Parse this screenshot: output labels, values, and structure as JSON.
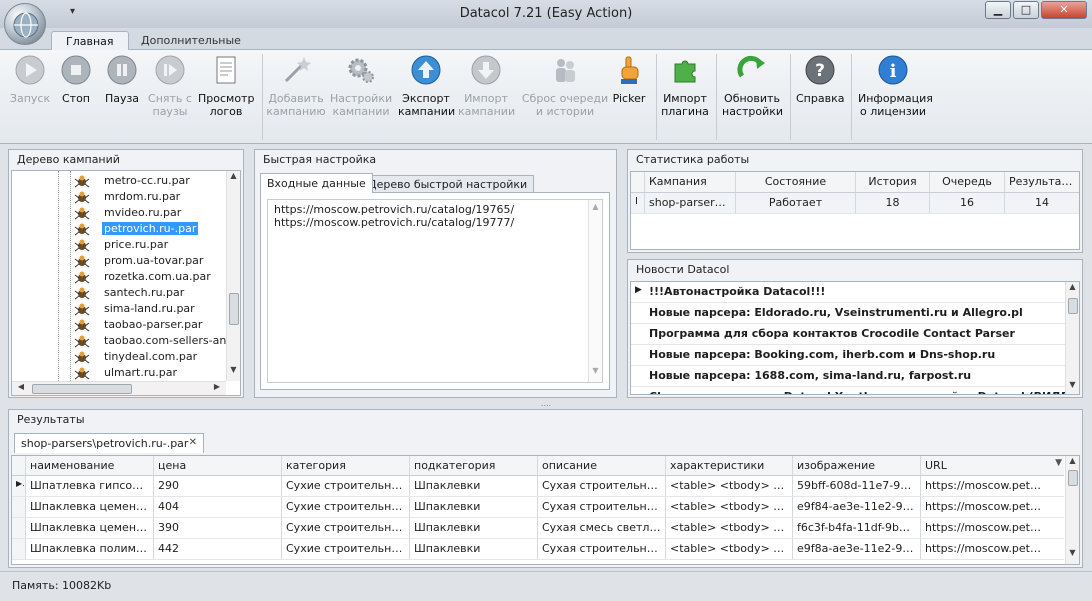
{
  "window": {
    "title": "Datacol 7.21 (Easy Action)",
    "qa_arrow": "▾",
    "min": "▁",
    "max": "□",
    "close": "✕"
  },
  "tabs": [
    {
      "label": "Главная"
    },
    {
      "label": "Дополнительные"
    }
  ],
  "ribbon": {
    "start": "Запуск",
    "stop": "Стоп",
    "pause": "Пауза",
    "unpause_1": "Снять с",
    "unpause_2": "паузы",
    "logs_1": "Просмотр",
    "logs_2": "логов",
    "add_1": "Добавить",
    "add_2": "кампанию",
    "settings_1": "Настройки",
    "settings_2": "кампании",
    "export_1": "Экспорт",
    "export_2": "кампании",
    "import_1": "Импорт",
    "import_2": "кампании",
    "reset_1": "Сброс очереди",
    "reset_2": "и истории",
    "picker": "Picker",
    "plugin_1": "Импорт",
    "plugin_2": "плагина",
    "update_1": "Обновить",
    "update_2": "настройки",
    "help": "Справка",
    "license_1": "Информация",
    "license_2": "о лицензии"
  },
  "tree": {
    "title": "Дерево кампаний",
    "items": [
      "metro-cc.ru.par",
      "mrdom.ru.par",
      "mvideo.ru.par",
      "petrovich.ru-.par",
      "price.ru.par",
      "prom.ua-tovar.par",
      "rozetka.com.ua.par",
      "santech.ru.par",
      "sima-land.ru.par",
      "taobao-parser.par",
      "taobao.com-sellers-and-pri",
      "tinydeal.com.par",
      "ulmart.ru.par"
    ]
  },
  "quick": {
    "title": "Быстрая настройка",
    "tab_input": "Входные данные",
    "tab_tree": "Дерево быстрой настройки",
    "line1": "https://moscow.petrovich.ru/catalog/19765/",
    "line2": "https://moscow.petrovich.ru/catalog/19777/"
  },
  "stats": {
    "title": "Статистика работы",
    "headers": [
      "Кампания",
      "Состояние",
      "История",
      "Очередь",
      "Результаты"
    ],
    "row": [
      "shop-parsers\\...",
      "Работает",
      "18",
      "16",
      "14"
    ]
  },
  "news": {
    "title": "Новости Datacol",
    "items": [
      "!!!Автонастройка Datacol!!!",
      "Новые парсера: Eldorado.ru, Vseinstrumenti.ru и Allegro.pl",
      "Программа для  сбора контактов Crocodile Contact Parser",
      "Новые парсера: Booking.com, iherb.com и Dns-shop.ru",
      "Новые парсера: 1688.com, sima-land.ru, farpost.ru",
      "Chrome расширение Datacol Xpath: для настройки Datacol (ВИДЕО)"
    ]
  },
  "results": {
    "title": "Результаты",
    "tab": "shop-parsers\\petrovich.ru-.par",
    "tab_close": "✕",
    "headers": [
      "наименование",
      "цена",
      "категория",
      "подкатегория",
      "описание",
      "характеристики",
      "изображение",
      "URL"
    ],
    "rows": [
      [
        "Шпатлевка гипсовая ...",
        "290",
        "Сухие строительные ...",
        "Шпаклевки",
        "Сухая строительная ...",
        "<table> <tbody> <tr...",
        "59bff-608d-11e7-9b5...",
        "https://moscow.petrovi..."
      ],
      [
        "Шпаклевка цементна...",
        "404",
        "Сухие строительные ...",
        "Шпаклевки",
        "Сухая строительная ...",
        "<table> <tbody> <tr...",
        "e9f84-ae3e-11e2-99f...",
        "https://moscow.petrovi..."
      ],
      [
        "Шпаклевка цементна...",
        "390",
        "Сухие строительные ...",
        "Шпаклевки",
        "Сухая смесь светло-с...",
        "<table> <tbody> <tr...",
        "f6c3f-b4fa-11df-9b7f...",
        "https://moscow.petrovi..."
      ],
      [
        "Шпаклевка полимерн...",
        "442",
        "Сухие строительные ...",
        "Шпаклевки",
        "Сухая строительная ...",
        "<table> <tbody> <tr...",
        "e9f8a-ae3e-11e2-99f...",
        "https://moscow.petrovi..."
      ]
    ]
  },
  "status": {
    "memory": "Память: 10082Kb"
  }
}
